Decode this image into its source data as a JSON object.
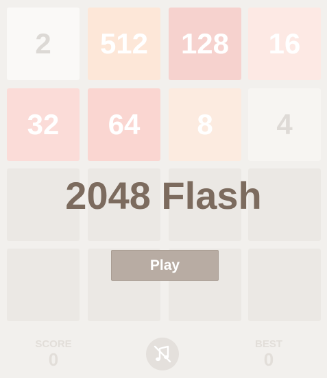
{
  "board": {
    "tiles": [
      {
        "value": "2"
      },
      {
        "value": "512"
      },
      {
        "value": "128"
      },
      {
        "value": "16"
      },
      {
        "value": "32"
      },
      {
        "value": "64"
      },
      {
        "value": "8"
      },
      {
        "value": "4"
      }
    ]
  },
  "overlay": {
    "title": "2048 Flash",
    "play_label": "Play"
  },
  "footer": {
    "score_label": "SCORE",
    "score_value": "0",
    "best_label": "BEST",
    "best_value": "0",
    "music_icon": "music-off-icon"
  }
}
